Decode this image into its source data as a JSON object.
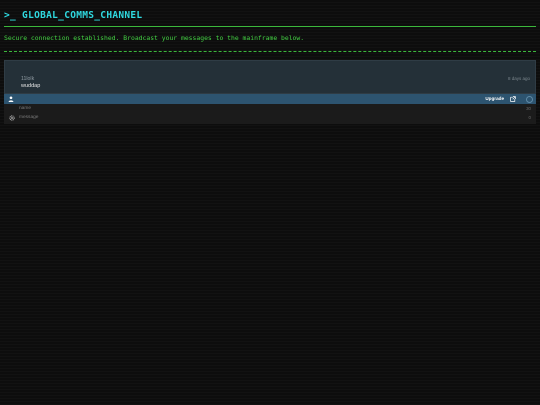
{
  "header": {
    "title": ">_ GLOBAL_COMMS_CHANNEL",
    "subtitle": "Secure connection established. Broadcast your messages to the mainframe below."
  },
  "chat": {
    "messages": [
      {
        "author": "11lolk",
        "text": "wuddap",
        "time": "8 days ago"
      }
    ],
    "toolbar": {
      "user_icon": "user-icon",
      "upgrade_label": "Upgrade",
      "external_icon": "external-link-icon"
    },
    "form": {
      "name_placeholder": "name",
      "name_counter": "30",
      "message_placeholder": "message",
      "message_counter": "0",
      "settings_icon": "gear-icon"
    }
  },
  "colors": {
    "accent": "#2fd9e0",
    "terminal_green": "#43d143",
    "background": "#0d0d0d",
    "toolbar_blue": "#2d5470"
  }
}
